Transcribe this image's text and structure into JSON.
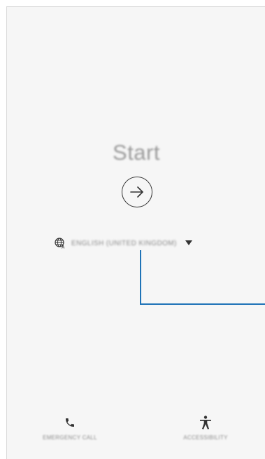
{
  "main": {
    "title": "Start",
    "start_button_icon": "arrow-right-circle-icon"
  },
  "language": {
    "icon": "globe-icon",
    "selected": "ENGLISH (UNITED KINGDOM)",
    "dropdown_icon": "triangle-down-icon"
  },
  "bottom_bar": {
    "emergency_call": {
      "icon": "phone-icon",
      "label": "EMERGENCY CALL"
    },
    "accessibility": {
      "icon": "accessibility-icon",
      "label": "ACCESSIBILITY"
    }
  },
  "colors": {
    "background": "#f6f6f6",
    "callout_line": "#1f73b7",
    "icon": "#333333"
  }
}
